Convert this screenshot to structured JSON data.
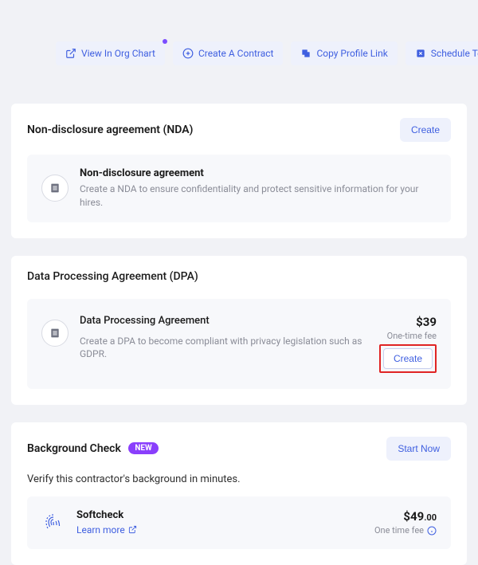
{
  "toolbar": {
    "view_org": "View In Org Chart",
    "create_contract": "Create A Contract",
    "copy_profile": "Copy Profile Link",
    "schedule_term": "Schedule Termination"
  },
  "nda": {
    "section_title": "Non-disclosure agreement (NDA)",
    "create_label": "Create",
    "item_title": "Non-disclosure agreement",
    "item_desc": "Create a NDA to ensure confidentiality and protect sensitive information for your hires."
  },
  "dpa": {
    "section_title": "Data Processing Agreement (DPA)",
    "item_title": "Data Processing Agreement",
    "item_desc": "Create a DPA to become compliant with privacy legislation such as GDPR.",
    "price": "$39",
    "fee_note": "One-time fee",
    "create_label": "Create"
  },
  "bg": {
    "section_title": "Background Check",
    "new_badge": "NEW",
    "start_label": "Start Now",
    "subtitle": "Verify this contractor's background in minutes.",
    "soft_title": "Softcheck",
    "learn_more": "Learn more",
    "soft_price_main": "$49",
    "soft_price_cents": ".00",
    "soft_fee_note": "One time fee"
  }
}
